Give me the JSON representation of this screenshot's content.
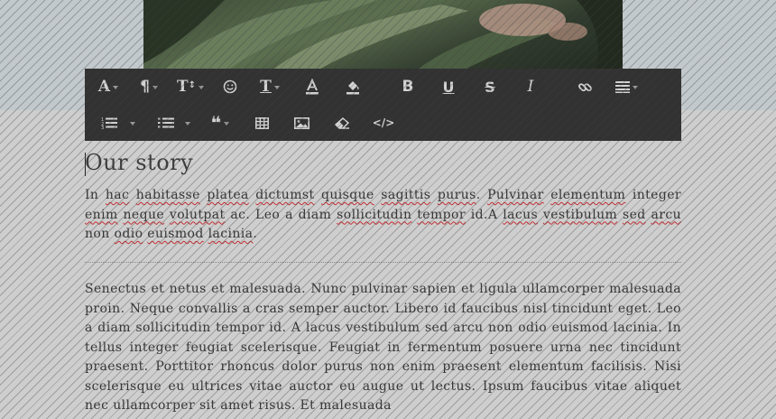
{
  "toolbar": {
    "row1": [
      {
        "name": "font-family-button",
        "glyph": "A",
        "caret": true
      },
      {
        "name": "paragraph-format-button",
        "glyph": "¶",
        "caret": true
      },
      {
        "name": "font-size-button",
        "glyph": "T↕",
        "caret": true
      },
      {
        "name": "emoticons-button",
        "glyph": "☺",
        "caret": false
      },
      {
        "name": "text-style-button",
        "glyph": "T",
        "caret": true
      },
      {
        "name": "text-color-button",
        "glyph": "A",
        "caret": false
      },
      {
        "name": "background-color-button",
        "glyph": "fill",
        "caret": false
      },
      {
        "name": "bold-button",
        "glyph": "B",
        "caret": false
      },
      {
        "name": "underline-button",
        "glyph": "U",
        "caret": false
      },
      {
        "name": "strikethrough-button",
        "glyph": "S",
        "caret": false
      },
      {
        "name": "italic-button",
        "glyph": "I",
        "caret": false
      },
      {
        "name": "insert-link-button",
        "glyph": "link",
        "caret": false
      },
      {
        "name": "align-button",
        "glyph": "align",
        "caret": true
      }
    ],
    "row2": [
      {
        "name": "ordered-list-button",
        "glyph": "ol",
        "caret": true
      },
      {
        "name": "unordered-list-button",
        "glyph": "ul",
        "caret": true
      },
      {
        "name": "quote-button",
        "glyph": "❝",
        "caret": true
      },
      {
        "name": "insert-table-button",
        "glyph": "table",
        "caret": false
      },
      {
        "name": "insert-image-button",
        "glyph": "image",
        "caret": false
      },
      {
        "name": "clear-formatting-button",
        "glyph": "eraser",
        "caret": false
      },
      {
        "name": "code-view-button",
        "glyph": "</>",
        "caret": false
      }
    ]
  },
  "editor": {
    "heading": "Our story",
    "paragraph1": [
      {
        "t": "In ",
        "sp": false
      },
      {
        "t": "hac",
        "sp": true
      },
      {
        "t": " ",
        "sp": false
      },
      {
        "t": "habitasse",
        "sp": true
      },
      {
        "t": " ",
        "sp": false
      },
      {
        "t": "platea",
        "sp": true
      },
      {
        "t": " ",
        "sp": false
      },
      {
        "t": "dictumst",
        "sp": true
      },
      {
        "t": " ",
        "sp": false
      },
      {
        "t": "quisque",
        "sp": true
      },
      {
        "t": " ",
        "sp": false
      },
      {
        "t": "sagittis",
        "sp": true
      },
      {
        "t": " ",
        "sp": false
      },
      {
        "t": "purus",
        "sp": true
      },
      {
        "t": ". ",
        "sp": false
      },
      {
        "t": "Pulvinar",
        "sp": true
      },
      {
        "t": " ",
        "sp": false
      },
      {
        "t": "elementum",
        "sp": true
      },
      {
        "t": " integer ",
        "sp": false
      },
      {
        "t": "enim",
        "sp": true
      },
      {
        "t": " ",
        "sp": false
      },
      {
        "t": "neque",
        "sp": true
      },
      {
        "t": " ",
        "sp": false
      },
      {
        "t": "volutpat",
        "sp": true
      },
      {
        "t": " ac. Leo a diam ",
        "sp": false
      },
      {
        "t": "sollicitudin",
        "sp": true
      },
      {
        "t": " ",
        "sp": false
      },
      {
        "t": "tempor",
        "sp": true
      },
      {
        "t": " id.A ",
        "sp": false
      },
      {
        "t": "lacus",
        "sp": true
      },
      {
        "t": " ",
        "sp": false
      },
      {
        "t": "vestibulum",
        "sp": true
      },
      {
        "t": " ",
        "sp": false
      },
      {
        "t": "sed",
        "sp": true
      },
      {
        "t": " ",
        "sp": false
      },
      {
        "t": "arcu",
        "sp": true
      },
      {
        "t": " non ",
        "sp": false
      },
      {
        "t": "odio",
        "sp": true
      },
      {
        "t": " ",
        "sp": false
      },
      {
        "t": "euismod",
        "sp": true
      },
      {
        "t": " ",
        "sp": false
      },
      {
        "t": "lacinia",
        "sp": true
      },
      {
        "t": ".",
        "sp": false
      }
    ],
    "paragraph2": "Senectus et netus et malesuada. Nunc pulvinar sapien et ligula ullamcorper malesuada proin. Neque convallis a cras semper auctor. Libero id faucibus nisl tincidunt eget. Leo a diam sollicitudin tempor id. A lacus vestibulum sed arcu non odio euismod lacinia. In tellus integer feugiat scelerisque. Feugiat in fermentum posuere urna nec tincidunt praesent. Porttitor rhoncus dolor purus non enim praesent elementum facilisis. Nisi scelerisque eu ultrices vitae auctor eu augue ut lectus. Ipsum faucibus vitae aliquet nec ullamcorper sit amet risus. Et malesuada"
  }
}
